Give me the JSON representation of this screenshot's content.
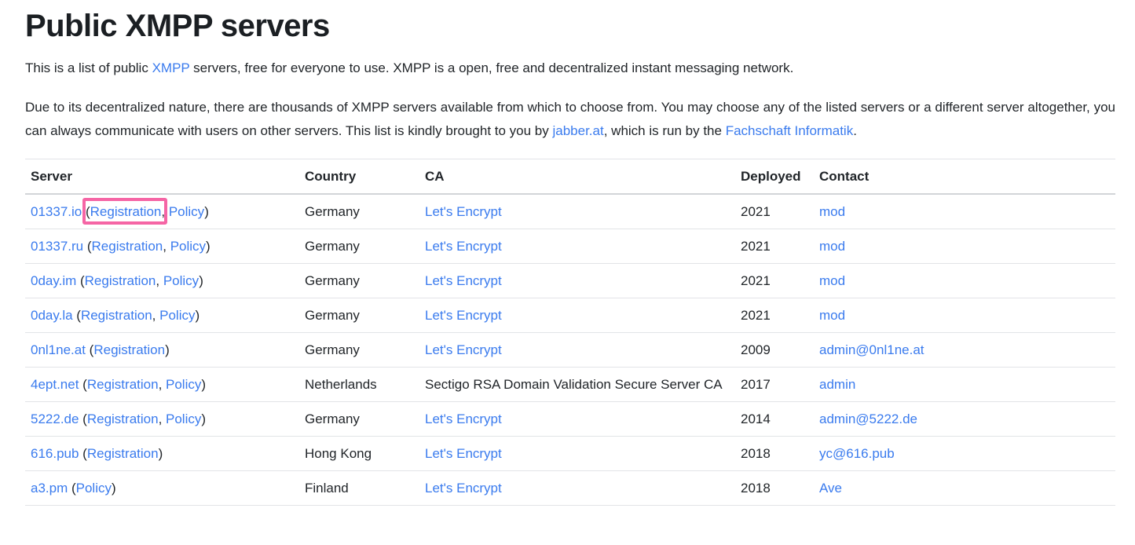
{
  "colors": {
    "link_blue": "#3a7bee",
    "highlight_pink": "#f565a5",
    "text": "#212529"
  },
  "header": {
    "title": "Public XMPP servers"
  },
  "intro": {
    "part1": "This is a list of public ",
    "xmpp_link": "XMPP",
    "part2": " servers, free for everyone to use. XMPP is a open, free and decentralized instant messaging network."
  },
  "description": {
    "part1": "Due to its decentralized nature, there are thousands of XMPP servers available from which to choose from. You may choose any of the listed servers or a different server altogether, you can always communicate with users on other servers. This list is kindly brought to you by ",
    "jabber_link": "jabber.at",
    "part2": ", which is run by the ",
    "fachschaft_link": "Fachschaft Informatik",
    "part3": "."
  },
  "table": {
    "headers": {
      "server": "Server",
      "country": "Country",
      "ca": "CA",
      "deployed": "Deployed",
      "contact": "Contact"
    },
    "punctuation": {
      "open": " (",
      "open_tight": "(",
      "comma": ", ",
      "comma_tight": ",",
      "space": " ",
      "close": ")"
    },
    "rows": [
      {
        "server": "01337.io",
        "registration": "Registration",
        "policy": "Policy",
        "country": "Germany",
        "ca": "Let's Encrypt",
        "ca_is_link": true,
        "deployed": "2021",
        "contact": "mod",
        "highlighted": true
      },
      {
        "server": "01337.ru",
        "registration": "Registration",
        "policy": "Policy",
        "country": "Germany",
        "ca": "Let's Encrypt",
        "ca_is_link": true,
        "deployed": "2021",
        "contact": "mod",
        "highlighted": false
      },
      {
        "server": "0day.im",
        "registration": "Registration",
        "policy": "Policy",
        "country": "Germany",
        "ca": "Let's Encrypt",
        "ca_is_link": true,
        "deployed": "2021",
        "contact": "mod",
        "highlighted": false
      },
      {
        "server": "0day.la",
        "registration": "Registration",
        "policy": "Policy",
        "country": "Germany",
        "ca": "Let's Encrypt",
        "ca_is_link": true,
        "deployed": "2021",
        "contact": "mod",
        "highlighted": false
      },
      {
        "server": "0nl1ne.at",
        "registration": "Registration",
        "policy": null,
        "country": "Germany",
        "ca": "Let's Encrypt",
        "ca_is_link": true,
        "deployed": "2009",
        "contact": "admin@0nl1ne.at",
        "highlighted": false
      },
      {
        "server": "4ept.net",
        "registration": "Registration",
        "policy": "Policy",
        "country": "Netherlands",
        "ca": "Sectigo RSA Domain Validation Secure Server CA",
        "ca_is_link": false,
        "deployed": "2017",
        "contact": "admin",
        "highlighted": false
      },
      {
        "server": "5222.de",
        "registration": "Registration",
        "policy": "Policy",
        "country": "Germany",
        "ca": "Let's Encrypt",
        "ca_is_link": true,
        "deployed": "2014",
        "contact": "admin@5222.de",
        "highlighted": false
      },
      {
        "server": "616.pub",
        "registration": "Registration",
        "policy": null,
        "country": "Hong Kong",
        "ca": "Let's Encrypt",
        "ca_is_link": true,
        "deployed": "2018",
        "contact": "yc@616.pub",
        "highlighted": false
      },
      {
        "server": "a3.pm",
        "registration": null,
        "policy": "Policy",
        "country": "Finland",
        "ca": "Let's Encrypt",
        "ca_is_link": true,
        "deployed": "2018",
        "contact": "Ave",
        "highlighted": false
      }
    ]
  }
}
